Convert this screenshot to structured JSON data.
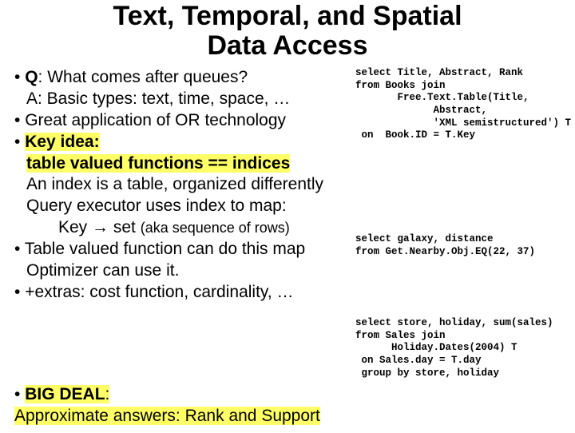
{
  "title_line1": "Text, Temporal, and Spatial",
  "title_line2": "Data Access",
  "bullets": {
    "b1a": "Q",
    "b1b": ": What comes after queues?",
    "b2a": "A:",
    "b2b": "  Basic types: text, time, space, …",
    "b3": "Great application of OR technology",
    "b4a": "Key idea:",
    "b4b": "table valued functions == indices",
    "b4c": "An index is a table, organized differently",
    "b4d": "Query executor uses index to map:",
    "b4e": "Key → set  ",
    "b4e_paren": "(aka sequence of rows)",
    "b5a": "Table valued function can do this map",
    "b5b": "Optimizer can use it.",
    "b6": "+extras: cost function, cardinality, …",
    "big_label": "BIG DEAL",
    "big_colon": ":",
    "big_line": "Approximate answers: Rank and Support"
  },
  "code1": {
    "l1": "select Title, Abstract, Rank",
    "l2": "from Books join",
    "l3": "       Free.Text.Table(Title,",
    "l4": "             Abstract,",
    "l5": "             'XML semistructured') T",
    "l6": " on  Book.ID = T.Key"
  },
  "code2": {
    "l1": "select galaxy, distance",
    "l2": "from Get.Nearby.Obj.EQ(22, 37)"
  },
  "code3": {
    "l1": "select store, holiday, sum(sales)",
    "l2": "from Sales join",
    "l3": "      Holiday.Dates(2004) T",
    "l4": " on Sales.day = T.day",
    "l5": " group by store, holiday"
  }
}
